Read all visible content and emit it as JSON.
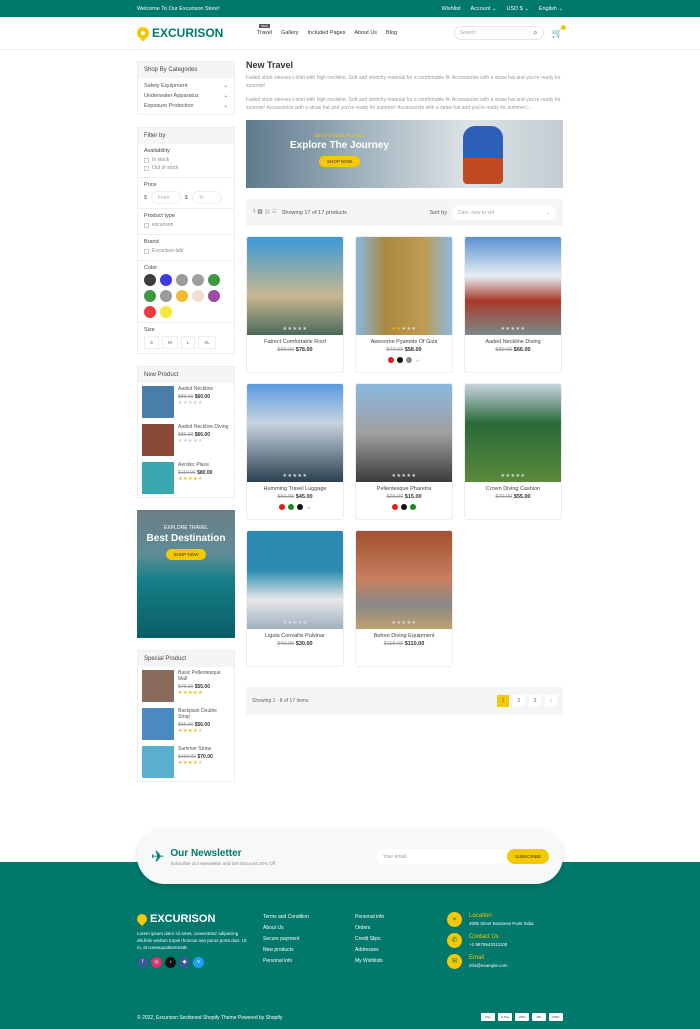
{
  "topbar": {
    "welcome": "Welcome To Our Excurison Store!",
    "wishlist": "Wishlist",
    "account": "Account ⌄",
    "currency": "USD $ ⌄",
    "language": "English ⌄"
  },
  "header": {
    "logo": "EXCURISON",
    "nav": [
      {
        "label": "Travel",
        "badge": "NEW"
      },
      {
        "label": "Gallery"
      },
      {
        "label": "Included Pages"
      },
      {
        "label": "About Us"
      },
      {
        "label": "Blog"
      }
    ],
    "search_placeholder": "Search",
    "search_icon": "⌕",
    "cart_icon": "🛒"
  },
  "categories": {
    "title": "Shop By Categories",
    "items": [
      "Safety Equipment",
      "Underwater Apparatus",
      "Exposure Protection"
    ]
  },
  "filter": {
    "title": "Filter by",
    "availability": "Availability",
    "in_stock": "In stock",
    "out_of_stock": "Out of stock",
    "price": "Price",
    "currency": "$",
    "from": "From",
    "to": "To",
    "product_type": "Product type",
    "type_option": "excurison",
    "brand": "Brand",
    "brand_option": "Excurison-lahl",
    "color": "Color",
    "colors": [
      "#3d3d3d",
      "#3c3ce6",
      "#9a9a9a",
      "#a0a0a0",
      "#3c9a3c",
      "#3c9a3c",
      "#9a9a9a",
      "#f5b830",
      "#f3dcd0",
      "#9b4ba6",
      "#f03c3c",
      "#f5e63c"
    ],
    "size": "Size",
    "sizes": [
      "S",
      "M",
      "L",
      "XL"
    ]
  },
  "new_product": {
    "title": "New Product",
    "items": [
      {
        "name": "Aaded Neckline",
        "old": "$80.00",
        "price": "$60.00",
        "rating": 0,
        "img": "#4a7ea8"
      },
      {
        "name": "Aaded Neckline Diving",
        "old": "$80.00",
        "price": "$66.00",
        "rating": 0,
        "img": "#8a4a3a"
      },
      {
        "name": "Aerobic Place",
        "old": "$110.00",
        "price": "$80.00",
        "rating": 4,
        "img": "#3aa6b0"
      }
    ]
  },
  "promo": {
    "sub": "EXPLORE TRAVEL",
    "title": "Best Destination",
    "button": "SHOP NOW"
  },
  "special_product": {
    "title": "Special Product",
    "items": [
      {
        "name": "Basic Pellentesque Mall",
        "old": "$78.00",
        "price": "$55.00",
        "rating": 5,
        "img": "#8a6a5a"
      },
      {
        "name": "Backpack Double Strap",
        "old": "$65.00",
        "price": "$56.00",
        "rating": 4,
        "img": "#4a8ac0"
      },
      {
        "name": "Summer Straw",
        "old": "$100.00",
        "price": "$70.00",
        "rating": 4,
        "img": "#5aaed0"
      }
    ]
  },
  "main": {
    "title": "New Travel",
    "desc1": "Faded short sleeves t-shirt with high neckline. Soft and stretchy material for a comfortable fit. Accessorize with a straw hat and you're ready for summer!",
    "desc2": "Faded short sleeves t-shirt with high neckline. Soft and stretchy material for a comfortable fit. Accessorize with a straw hat and you're ready for summer! Accessorize with a straw hat and you're ready for summer! Accessorize with a straw hat and you're ready for summer!..."
  },
  "banner": {
    "sub": "BEST TRAVEL PLACES",
    "title": "Explore The Journey",
    "button": "SHOP NOW"
  },
  "toolbar": {
    "showing": "Showing 17 of 17 products",
    "sort_label": "Sort by",
    "sort_value": "Date, new to old"
  },
  "products": [
    {
      "name": "Fatrect Comfortable Roof",
      "old": "$90.00",
      "price": "$78.00",
      "rating": 0,
      "img": "linear-gradient(#3a9ad8,#c8b890 60%,#4a6a5a)",
      "swatches": []
    },
    {
      "name": "Awesome Pyamids Of Giza",
      "old": "$77.00",
      "price": "$58.00",
      "rating": 2,
      "img": "linear-gradient(90deg,#8ab8e0,#a88a40 30%,#c09a50 70%,#8ab8e0)",
      "swatches": [
        "#e02020",
        "#111111",
        "#888888"
      ],
      "more": "+1"
    },
    {
      "name": "Aaded Neckline Diving",
      "old": "$80.00",
      "price": "$66.00",
      "rating": 0,
      "img": "linear-gradient(#5a90d0,#e8eef4 40%,#a83a2a 65%,#7a8a8a)",
      "swatches": []
    },
    {
      "name": "Humming Travel Luggage",
      "old": "$60.00",
      "price": "$45.00",
      "rating": 0,
      "img": "linear-gradient(#5a9ae0,#c8d4e0 40%,#2a4050)",
      "swatches": [
        "#e02020",
        "#1a8a1a",
        "#111111"
      ],
      "more": "+1"
    },
    {
      "name": "Pellentesque Pharetra",
      "old": "$25.00",
      "price": "$15.00",
      "rating": 0,
      "img": "linear-gradient(#8ab8e0,#a0a0a0 50%,#3a3a3a)",
      "swatches": [
        "#e02020",
        "#111111",
        "#1a8a1a"
      ]
    },
    {
      "name": "Crown Diving Cashion",
      "old": "$70.00",
      "price": "$55.00",
      "rating": 0,
      "img": "linear-gradient(#c8d4e0,#2a6a3a 40%,#5a8a3a)",
      "swatches": []
    },
    {
      "name": "Ligula Convallis Pulvinar",
      "old": "$40.00",
      "price": "$30.00",
      "rating": 0,
      "img": "linear-gradient(#2a8ab0 40%,#e8e8e8 70%,#a0b0c0)",
      "swatches": []
    },
    {
      "name": "Before Diving Equipment",
      "old": "$115.00",
      "price": "$110.00",
      "rating": 0,
      "img": "linear-gradient(#a05030,#c88060 50%,#888 75%,#c0a070)",
      "swatches": []
    }
  ],
  "pager": {
    "showing": "Showing 1 - 8 of 17 items",
    "pages": [
      "1",
      "2",
      "3",
      "›"
    ],
    "current": "1"
  },
  "newsletter": {
    "title": "Our Newsletter",
    "sub": "Subscribe Our Newsletter and Get Discount 20% Off",
    "placeholder": "Your email",
    "button": "SUBSCRIBE"
  },
  "footer": {
    "logo": "EXCURISON",
    "about": "Lorem ipsum dolor sit amet, consectetur adipiscing elit.felis veulum turpis rhoncus non purus porta duis. Ut m, at consequatlorem4dc",
    "social": [
      "f",
      "◎",
      "♪",
      "◆",
      "v"
    ],
    "social_colors": [
      "#3b5998",
      "#d6336c",
      "#111111",
      "#3b5998",
      "#1da1f2"
    ],
    "links1": [
      "Terms and Condition",
      "About Us",
      "Secure payment",
      "New products",
      "Personal info"
    ],
    "links2": [
      "Personal info",
      "Orders",
      "Credit Slips",
      "Addresses",
      "My Wishlists"
    ],
    "location_title": "Location",
    "location": "4005 Silver Business Point India",
    "contact_title": "Contact Us",
    "phone": "+1 9876543211100",
    "email_title": "Email",
    "email": "info@example.com",
    "copyright": "© 2022, Excurison Sectioned Shopify Theme Powered by Shopify",
    "payments": [
      "Pay",
      "G Pay",
      "VISA",
      "MC",
      "DISC"
    ]
  }
}
